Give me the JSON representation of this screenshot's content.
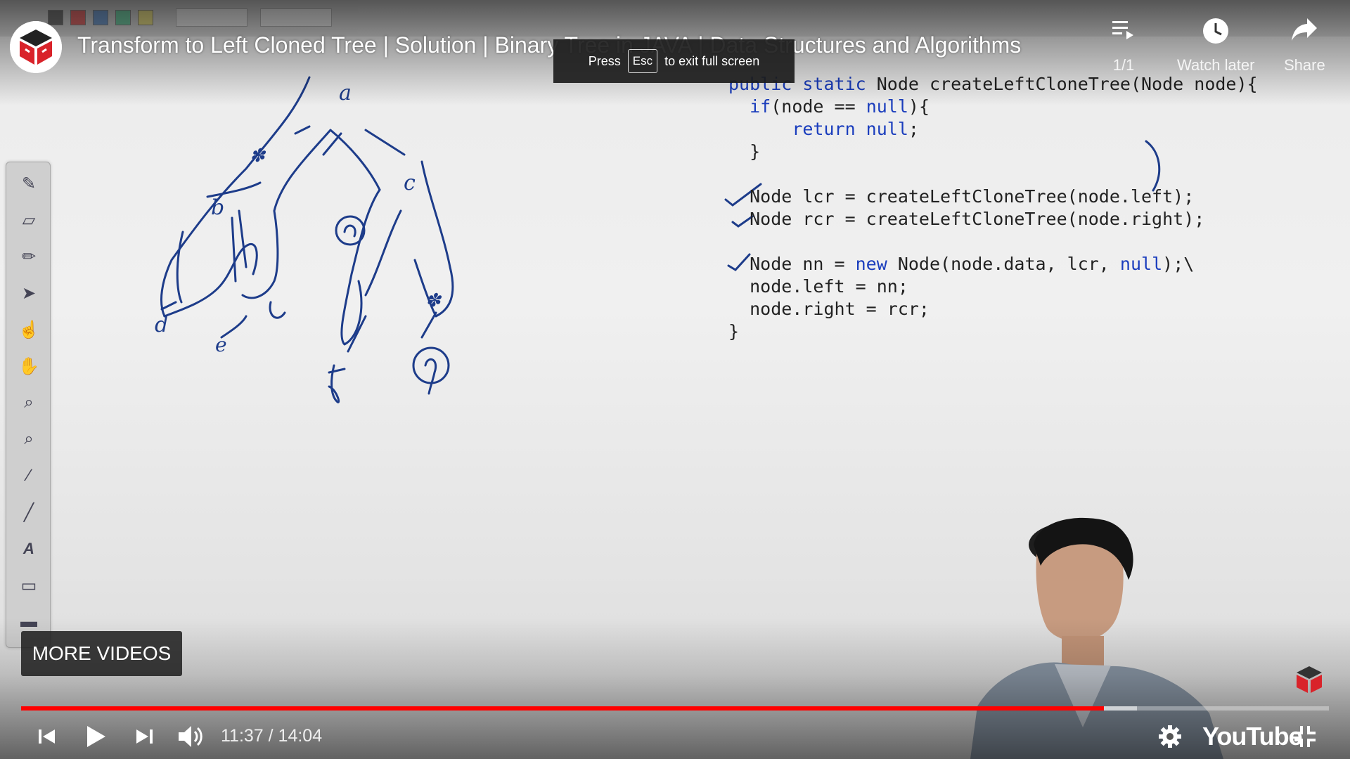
{
  "video": {
    "title": "Transform to Left Cloned Tree | Solution | Binary Tree in JAVA | Data Structures and Algorithms",
    "fullscreen_hint": {
      "prefix": "Press",
      "key": "Esc",
      "suffix": "to exit full screen"
    },
    "playlist_counter": "1/1",
    "watch_later_label": "Watch later",
    "share_label": "Share",
    "more_videos_label": "MORE VIDEOS",
    "current_time": "11:37",
    "duration": "14:04",
    "time_display": "11:37 / 14:04",
    "progress": {
      "played_fraction": 0.8278,
      "buffered_fraction": 0.8532
    },
    "brand": "YouTube"
  },
  "code": {
    "lines": [
      [
        {
          "t": "public static",
          "k": true
        },
        {
          "t": " Node createLeftCloneTree(Node node){",
          "k": false
        }
      ],
      [
        {
          "t": "  ",
          "k": false
        },
        {
          "t": "if",
          "k": true
        },
        {
          "t": "(node == ",
          "k": false
        },
        {
          "t": "null",
          "k": true
        },
        {
          "t": "){",
          "k": false
        }
      ],
      [
        {
          "t": "      ",
          "k": false
        },
        {
          "t": "return null",
          "k": true
        },
        {
          "t": ";",
          "k": false
        }
      ],
      [
        {
          "t": "  }",
          "k": false
        }
      ],
      [
        {
          "t": "",
          "k": false
        }
      ],
      [
        {
          "t": "  Node lcr = createLeftCloneTree(node.left);",
          "k": false
        }
      ],
      [
        {
          "t": "  Node rcr = createLeftCloneTree(node.right);",
          "k": false
        }
      ],
      [
        {
          "t": "",
          "k": false
        }
      ],
      [
        {
          "t": "  Node nn = ",
          "k": false
        },
        {
          "t": "new",
          "k": true
        },
        {
          "t": " Node(node.data, lcr, ",
          "k": false
        },
        {
          "t": "null",
          "k": true
        },
        {
          "t": ");\\",
          "k": false
        }
      ],
      [
        {
          "t": "  node.left = nn;",
          "k": false
        }
      ],
      [
        {
          "t": "  node.right = rcr;",
          "k": false
        }
      ],
      [
        {
          "t": "}",
          "k": false
        }
      ]
    ]
  },
  "colors": {
    "progress_played": "#ff0000",
    "ink": "#1d3c8a",
    "keyword": "#1a3dbd"
  }
}
